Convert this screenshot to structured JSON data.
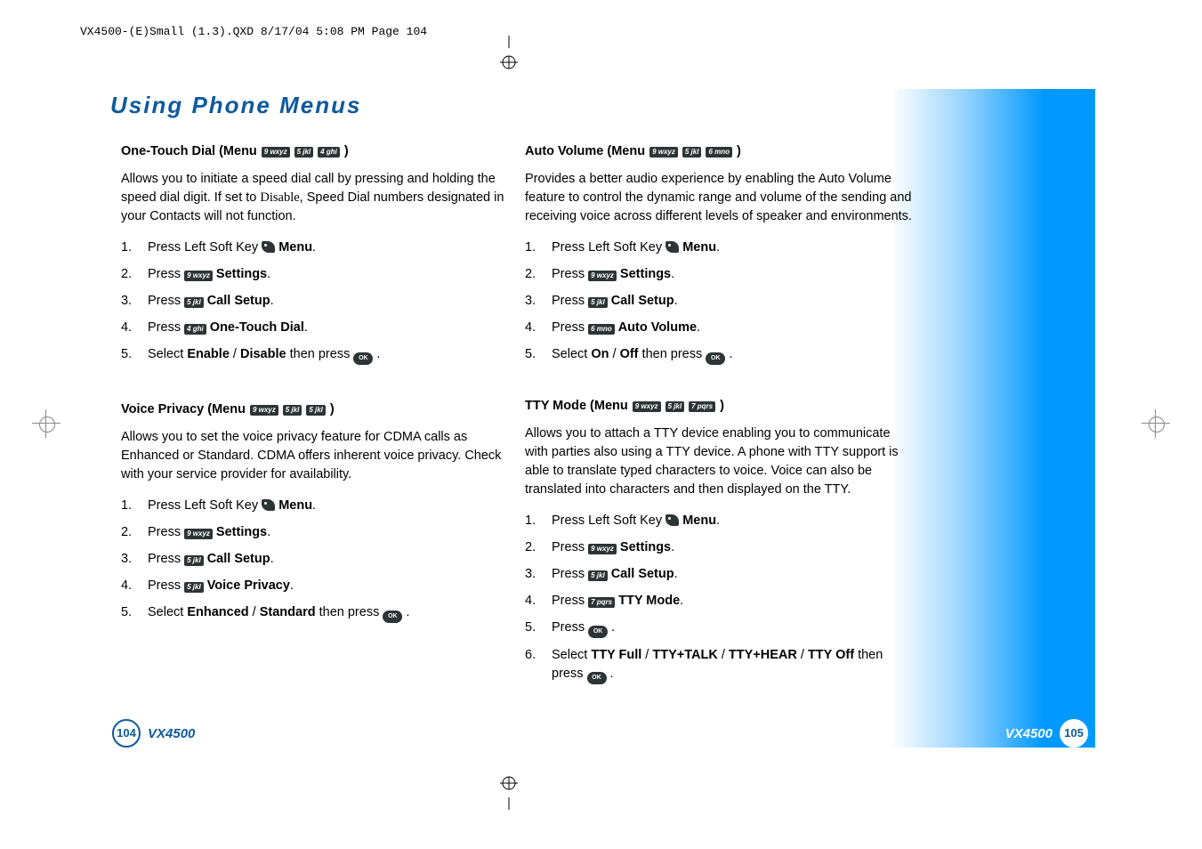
{
  "filepath": "VX4500-(E)Small (1.3).QXD  8/17/04  5:08 PM  Page 104",
  "title": "Using Phone Menus",
  "page_left_num": "104",
  "page_right_num": "105",
  "model": "VX4500",
  "keys": {
    "9": "9 wxyz",
    "5": "5 jkl",
    "4": "4 ghi",
    "6": "6 mno",
    "7": "7 pqrs",
    "ok": "OK"
  },
  "sections": {
    "one_touch": {
      "head_pre": "One-Touch Dial (Menu",
      "head_post": ")",
      "intro_a": "Allows you to initiate a speed dial call by pressing and holding the speed dial digit. If set to ",
      "intro_i": "Disable",
      "intro_b": ", Speed Dial numbers designated in your Contacts will not function.",
      "s1_a": "Press Left Soft Key ",
      "s1_b": "Menu",
      "s1_c": ".",
      "s2_a": "Press ",
      "s2_b": "Settings",
      "s2_c": ".",
      "s3_a": "Press ",
      "s3_b": "Call Setup",
      "s3_c": ".",
      "s4_a": "Press ",
      "s4_b": "One-Touch Dial",
      "s4_c": ".",
      "s5_a": "Select ",
      "s5_b": "Enable",
      "s5_c": " / ",
      "s5_d": "Disable",
      "s5_e": " then press ",
      "s5_f": "."
    },
    "voice_priv": {
      "head_pre": "Voice Privacy (Menu",
      "head_post": ")",
      "intro": "Allows you to set the voice privacy feature for CDMA calls as Enhanced or Standard. CDMA offers inherent voice privacy. Check with your service provider for availability.",
      "s1_a": "Press Left Soft Key ",
      "s1_b": "Menu",
      "s1_c": ".",
      "s2_a": "Press ",
      "s2_b": "Settings",
      "s2_c": ".",
      "s3_a": "Press ",
      "s3_b": "Call Setup",
      "s3_c": ".",
      "s4_a": "Press ",
      "s4_b": "Voice Privacy",
      "s4_c": ".",
      "s5_a": "Select ",
      "s5_b": "Enhanced",
      "s5_c": " / ",
      "s5_d": "Standard",
      "s5_e": " then press ",
      "s5_f": "."
    },
    "auto_vol": {
      "head_pre": "Auto Volume (Menu",
      "head_post": ")",
      "intro": "Provides a better audio experience by enabling the Auto Volume feature to control the dynamic range and volume of the sending and receiving voice across different levels of speaker and environments.",
      "s1_a": "Press Left Soft Key ",
      "s1_b": "Menu",
      "s1_c": ".",
      "s2_a": "Press ",
      "s2_b": "Settings",
      "s2_c": ".",
      "s3_a": "Press ",
      "s3_b": "Call Setup",
      "s3_c": ".",
      "s4_a": "Press ",
      "s4_b": "Auto Volume",
      "s4_c": ".",
      "s5_a": "Select ",
      "s5_b": "On",
      "s5_c": " / ",
      "s5_d": "Off",
      "s5_e": " then press ",
      "s5_f": "."
    },
    "tty": {
      "head_pre": "TTY Mode (Menu",
      "head_post": ")",
      "intro": "Allows you to attach a TTY device enabling you to communicate with parties also using a TTY device. A phone with TTY support is able to translate typed characters to voice. Voice can also be translated into characters and then displayed on the TTY.",
      "s1_a": "Press Left Soft Key ",
      "s1_b": "Menu",
      "s1_c": ".",
      "s2_a": "Press ",
      "s2_b": "Settings",
      "s2_c": ".",
      "s3_a": "Press ",
      "s3_b": "Call Setup",
      "s3_c": ".",
      "s4_a": "Press ",
      "s4_b": "TTY Mode",
      "s4_c": ".",
      "s5_a": "Press ",
      "s5_b": ".",
      "s6_a": "Select ",
      "s6_b": "TTY Full",
      "s6_c": " / ",
      "s6_d": "TTY+TALK",
      "s6_e": " / ",
      "s6_f": "TTY+HEAR",
      "s6_g": " / ",
      "s6_h": "TTY Off",
      "s6_i": " then press ",
      "s6_j": "."
    }
  }
}
